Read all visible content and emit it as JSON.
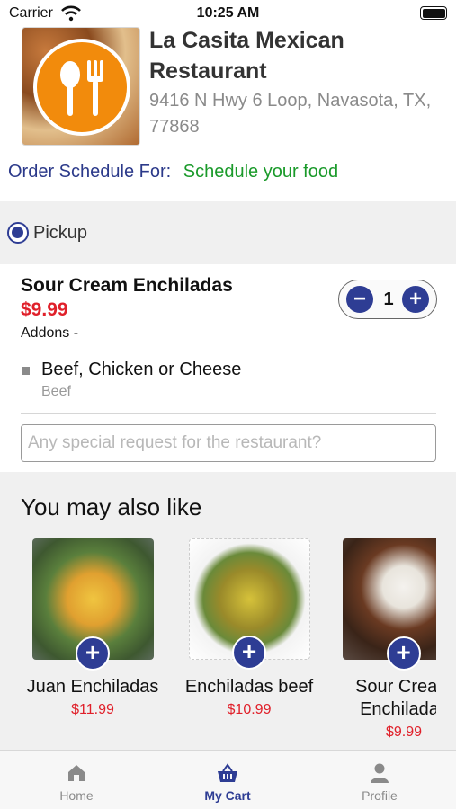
{
  "status_bar": {
    "carrier": "Carrier",
    "time": "10:25 AM"
  },
  "restaurant": {
    "name": "La Casita Mexican Restaurant",
    "address": "9416 N Hwy 6 Loop, Navasota, TX, 77868",
    "logo_icon": "fork-spoon-icon"
  },
  "schedule": {
    "label": "Order Schedule For:",
    "value": "Schedule your food"
  },
  "order_type": {
    "selected": "Pickup"
  },
  "cart_item": {
    "name": "Sour Cream Enchiladas",
    "price": "$9.99",
    "addons_label": "Addons -",
    "quantity": "1",
    "addon": {
      "name": "Beef, Chicken or Cheese",
      "value": "Beef"
    }
  },
  "special_request": {
    "placeholder": "Any special request for the restaurant?"
  },
  "also_like": {
    "title": "You may also like",
    "items": [
      {
        "name": "Juan Enchiladas",
        "price": "$11.99"
      },
      {
        "name": "Enchiladas beef",
        "price": "$10.99"
      },
      {
        "name": "Sour Cream Enchiladas",
        "price": "$9.99"
      }
    ]
  },
  "tab_bar": {
    "tabs": [
      {
        "label": "Home",
        "icon": "home-icon"
      },
      {
        "label": "My Cart",
        "icon": "basket-icon"
      },
      {
        "label": "Profile",
        "icon": "person-icon"
      }
    ],
    "active": "My Cart"
  },
  "colors": {
    "accent": "#2e3d94",
    "price": "#e0202a",
    "schedule_value": "#1a9a2a",
    "logo_orange": "#f28b0c"
  }
}
